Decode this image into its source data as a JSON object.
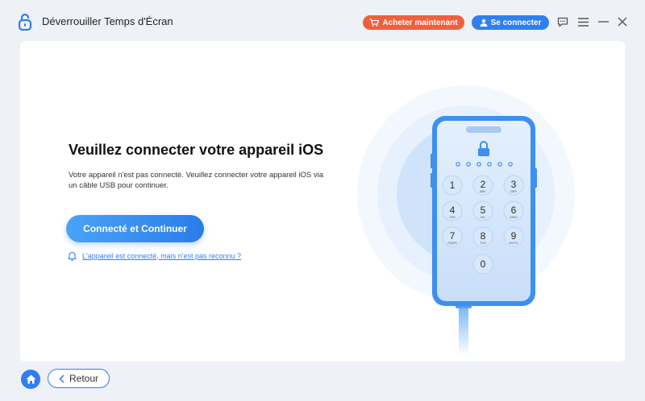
{
  "window": {
    "title": "Déverrouiller Temps d'Écran",
    "buy_label": "Acheter maintenant",
    "login_label": "Se connecter",
    "icons": [
      "feedback-icon",
      "menu-icon",
      "minimize-icon",
      "close-icon"
    ]
  },
  "main": {
    "headline": "Veuillez connecter votre appareil iOS",
    "description": "Votre appareil n'est pas connecté. Veuillez connecter votre appareil iOS via un câble USB pour continuer.",
    "continue_label": "Connecté et Continuer",
    "help_link": "L'appareil est connecté, mais n'est pas reconnu ?"
  },
  "phone": {
    "keys": [
      {
        "num": "1",
        "sub": ""
      },
      {
        "num": "2",
        "sub": "ABC"
      },
      {
        "num": "3",
        "sub": "DEF"
      },
      {
        "num": "4",
        "sub": "GHI"
      },
      {
        "num": "5",
        "sub": "JKL"
      },
      {
        "num": "6",
        "sub": "MNO"
      },
      {
        "num": "7",
        "sub": "PQRS"
      },
      {
        "num": "8",
        "sub": "TUV"
      },
      {
        "num": "9",
        "sub": "WXYZ"
      },
      {
        "num": "0",
        "sub": ""
      }
    ]
  },
  "footer": {
    "back_label": "Retour"
  },
  "colors": {
    "accent": "#2f7ff0",
    "buy": "#f0603e",
    "background": "#eef1f6"
  }
}
